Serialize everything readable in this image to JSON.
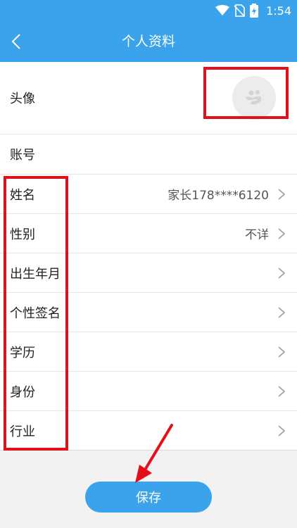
{
  "status_bar": {
    "time": "1:54"
  },
  "header": {
    "title": "个人资料"
  },
  "profile": {
    "avatar_label": "头像",
    "account_label": "账号",
    "rows": [
      {
        "label": "姓名",
        "value": "家长178****6120"
      },
      {
        "label": "性别",
        "value": "不详"
      },
      {
        "label": "出生年月",
        "value": ""
      },
      {
        "label": "个性签名",
        "value": ""
      },
      {
        "label": "学历",
        "value": ""
      },
      {
        "label": "身份",
        "value": ""
      },
      {
        "label": "行业",
        "value": ""
      }
    ]
  },
  "actions": {
    "save_label": "保存"
  },
  "colors": {
    "accent": "#3aa3ec",
    "annotation": "#e3101c",
    "divider": "#e6e6e6"
  }
}
